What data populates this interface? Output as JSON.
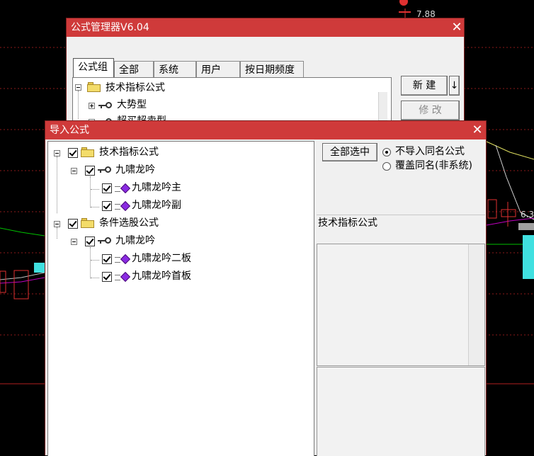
{
  "chart": {
    "price_top": "7.88",
    "price_right": "6.3"
  },
  "manager_window": {
    "title": "公式管理器V6.04",
    "close_glyph": "✕",
    "tabs": [
      {
        "label": "公式组"
      },
      {
        "label": "全部"
      },
      {
        "label": "系统"
      },
      {
        "label": "用户"
      },
      {
        "label": "按日期频度"
      }
    ],
    "tree": {
      "root": "技术指标公式",
      "child1": "大势型",
      "child2": "超买超卖型"
    },
    "buttons": {
      "new": "新 建",
      "arrow": "↓",
      "edit": "修 改"
    }
  },
  "import_window": {
    "title": "导入公式",
    "close_glyph": "✕",
    "tree": {
      "group1": "技术指标公式",
      "group1_sub": "九啸龙吟",
      "group1_item1": "九啸龙吟主",
      "group1_item2": "九啸龙吟副",
      "group2": "条件选股公式",
      "group2_sub": "九啸龙吟",
      "group2_item1": "九啸龙吟二板",
      "group2_item2": "九啸龙吟首板"
    },
    "select_all": "全部选中",
    "options": {
      "no_import_same": "不导入同名公式",
      "overwrite_same": "覆盖同名(非系统)",
      "selected": "no_import_same"
    },
    "info_label": "技术指标公式"
  },
  "colors": {
    "titlebar": "#cf3a3a",
    "window_bg": "#f0f0f0",
    "chart_bg": "#000000"
  }
}
